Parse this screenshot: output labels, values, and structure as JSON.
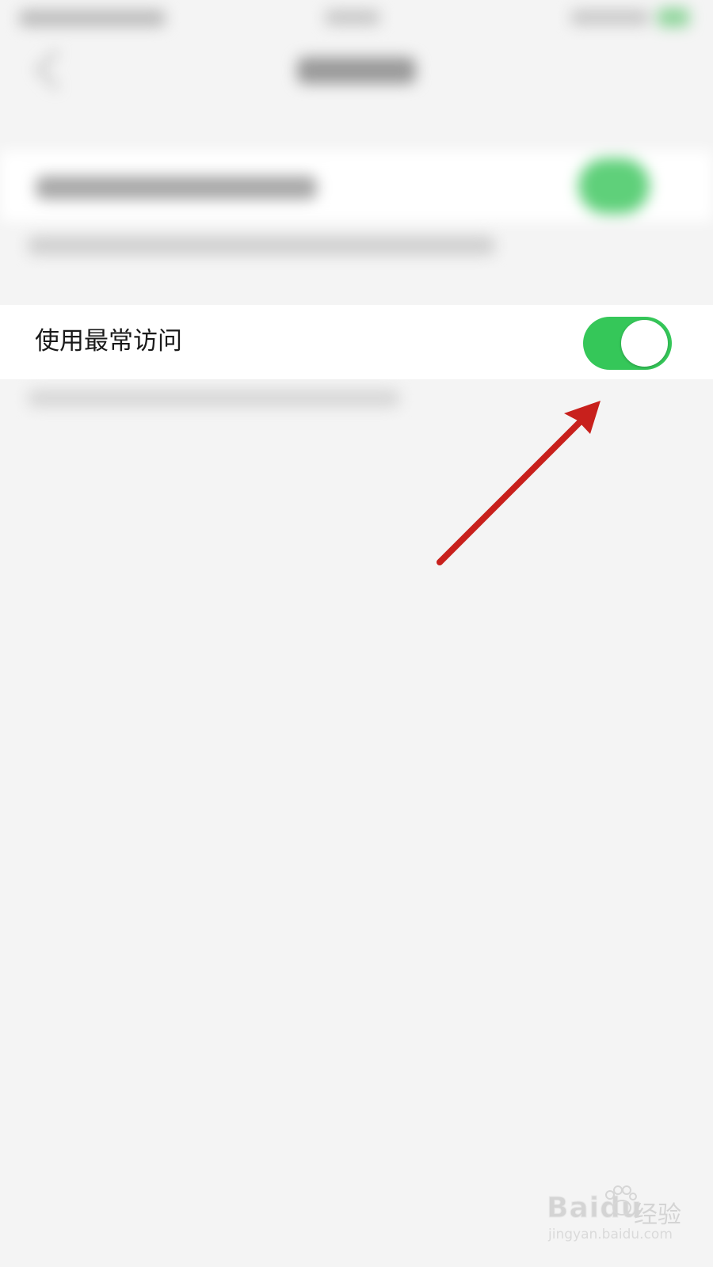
{
  "settings": {
    "row_label": "使用最常访问",
    "toggle_on": true
  },
  "watermark": {
    "logo": "Baidu",
    "cn": "经验",
    "url": "jingyan.baidu.com"
  },
  "colors": {
    "toggle_on": "#35c759",
    "arrow": "#c8201c",
    "background": "#f4f4f4"
  }
}
